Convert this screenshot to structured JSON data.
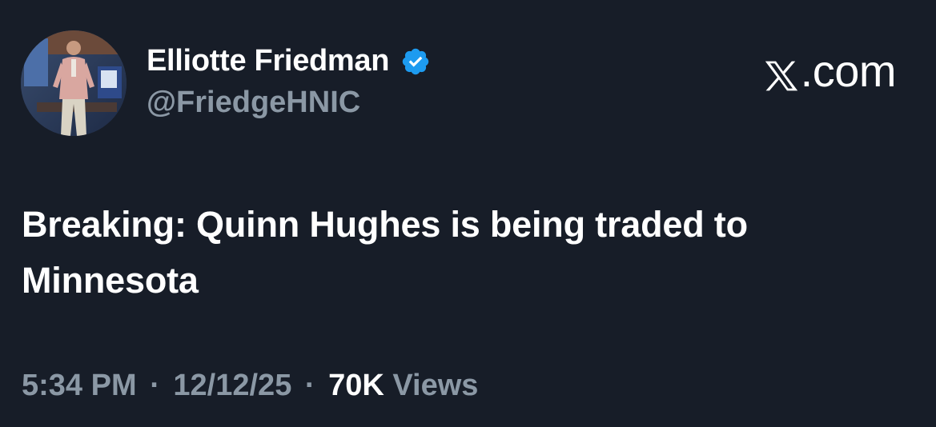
{
  "author": {
    "display_name": "Elliotte Friedman",
    "handle": "@FriedgeHNIC",
    "verified_icon": "verified-badge-icon",
    "verified_color": "#1d9bf0"
  },
  "brand": {
    "icon": "x-logo-icon",
    "text": ".com"
  },
  "tweet": {
    "text": "Breaking: Quinn Hughes is being traded to Minnesota"
  },
  "meta": {
    "time": "5:34 PM",
    "separator": "·",
    "date": "12/12/25",
    "views_count": "70K",
    "views_label": "Views"
  },
  "colors": {
    "background": "#171d28",
    "primary_text": "#ffffff",
    "secondary_text": "#8b98a5"
  }
}
